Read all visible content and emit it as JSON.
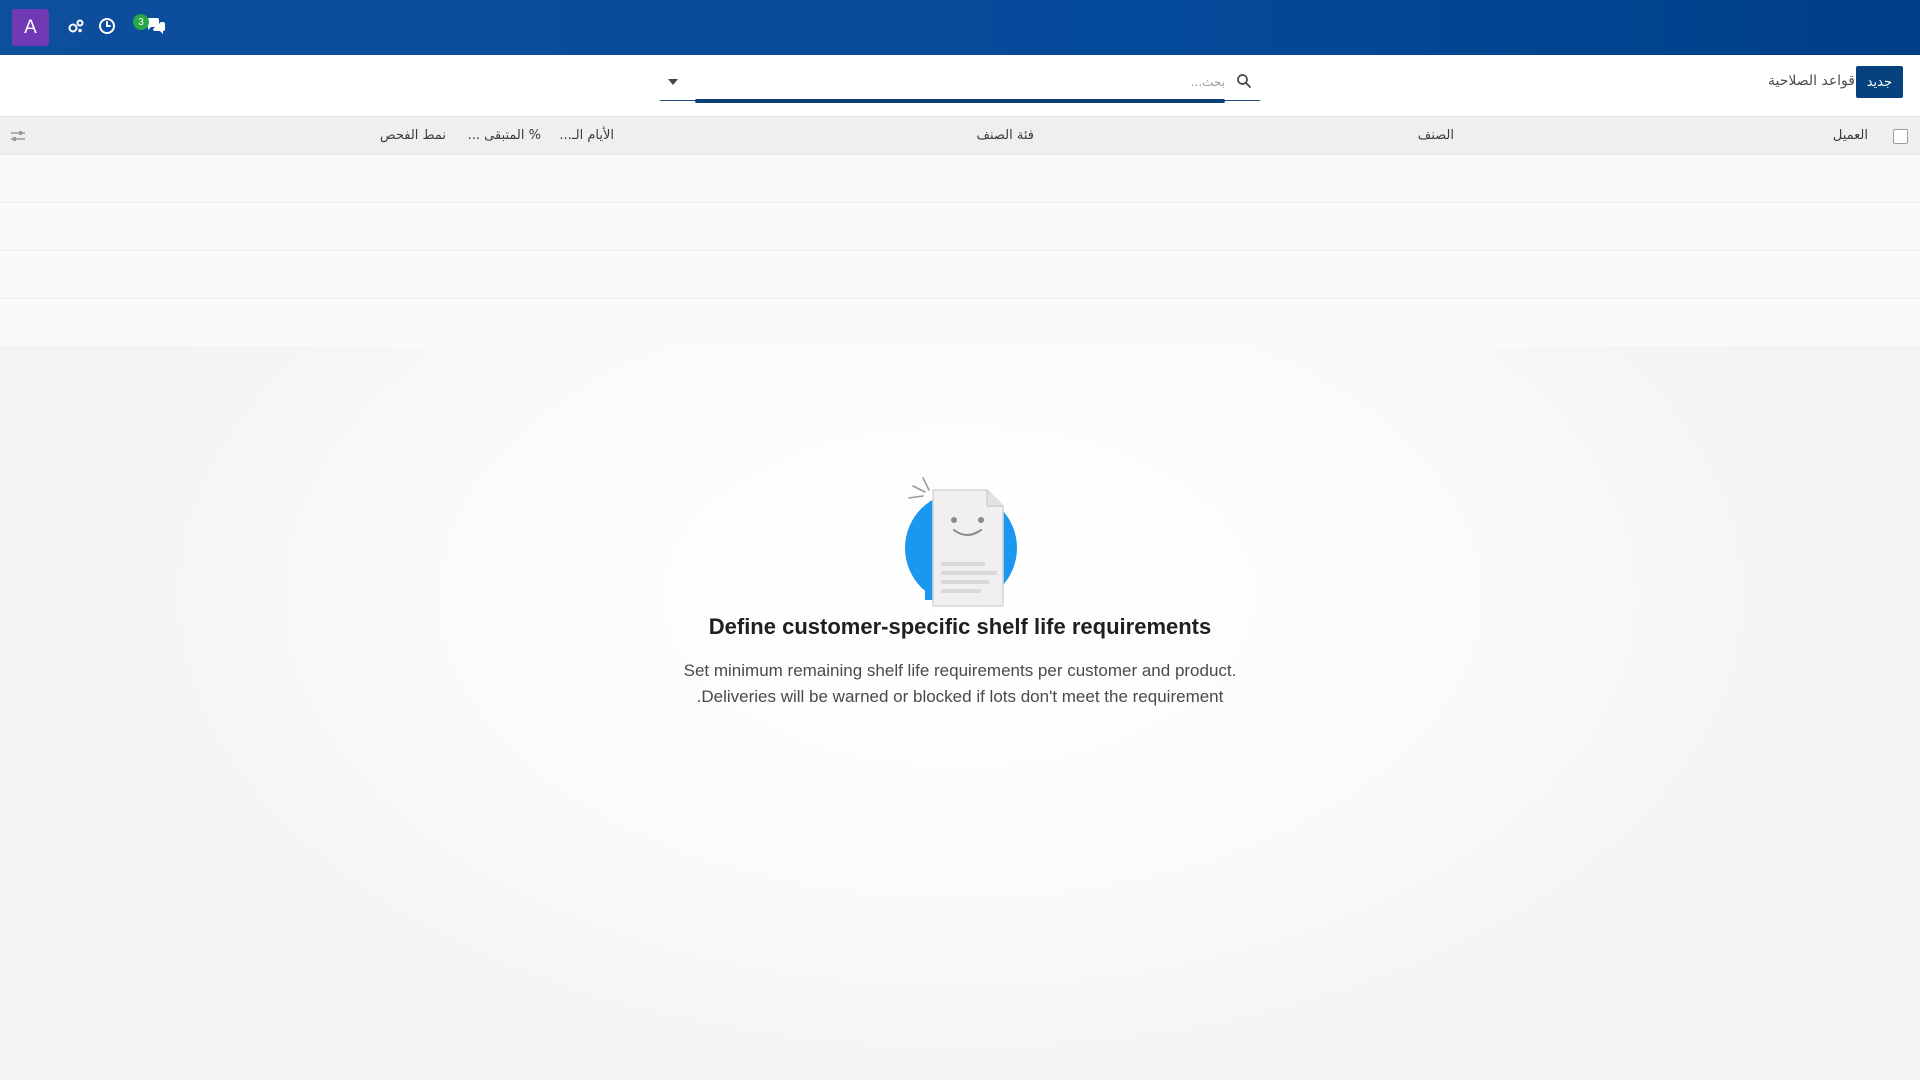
{
  "navbar": {
    "avatar_letter": "A",
    "icons": [
      "activity-icon",
      "clock-icon",
      "chat-icon"
    ],
    "messages_badge": "3",
    "accent_color": "#0e4f9c"
  },
  "control_panel": {
    "new_button_label": "جديد",
    "breadcrumb_title": "قواعد الصلاحية",
    "search": {
      "placeholder": "بحث...",
      "value": ""
    }
  },
  "list": {
    "columns": {
      "customer": "العميل",
      "product": "الصنف",
      "product_category": "فئة الصنف",
      "min_days": "الأيام الـ...",
      "remaining_percent": "% المتبقى ...",
      "check_mode": "نمط الفحص"
    }
  },
  "empty_state": {
    "title": "Define customer-specific shelf life requirements",
    "line1": "Set minimum remaining shelf life requirements per customer and product.",
    "line2": ".Deliveries will be warned or blocked if lots don't meet the requirement"
  }
}
